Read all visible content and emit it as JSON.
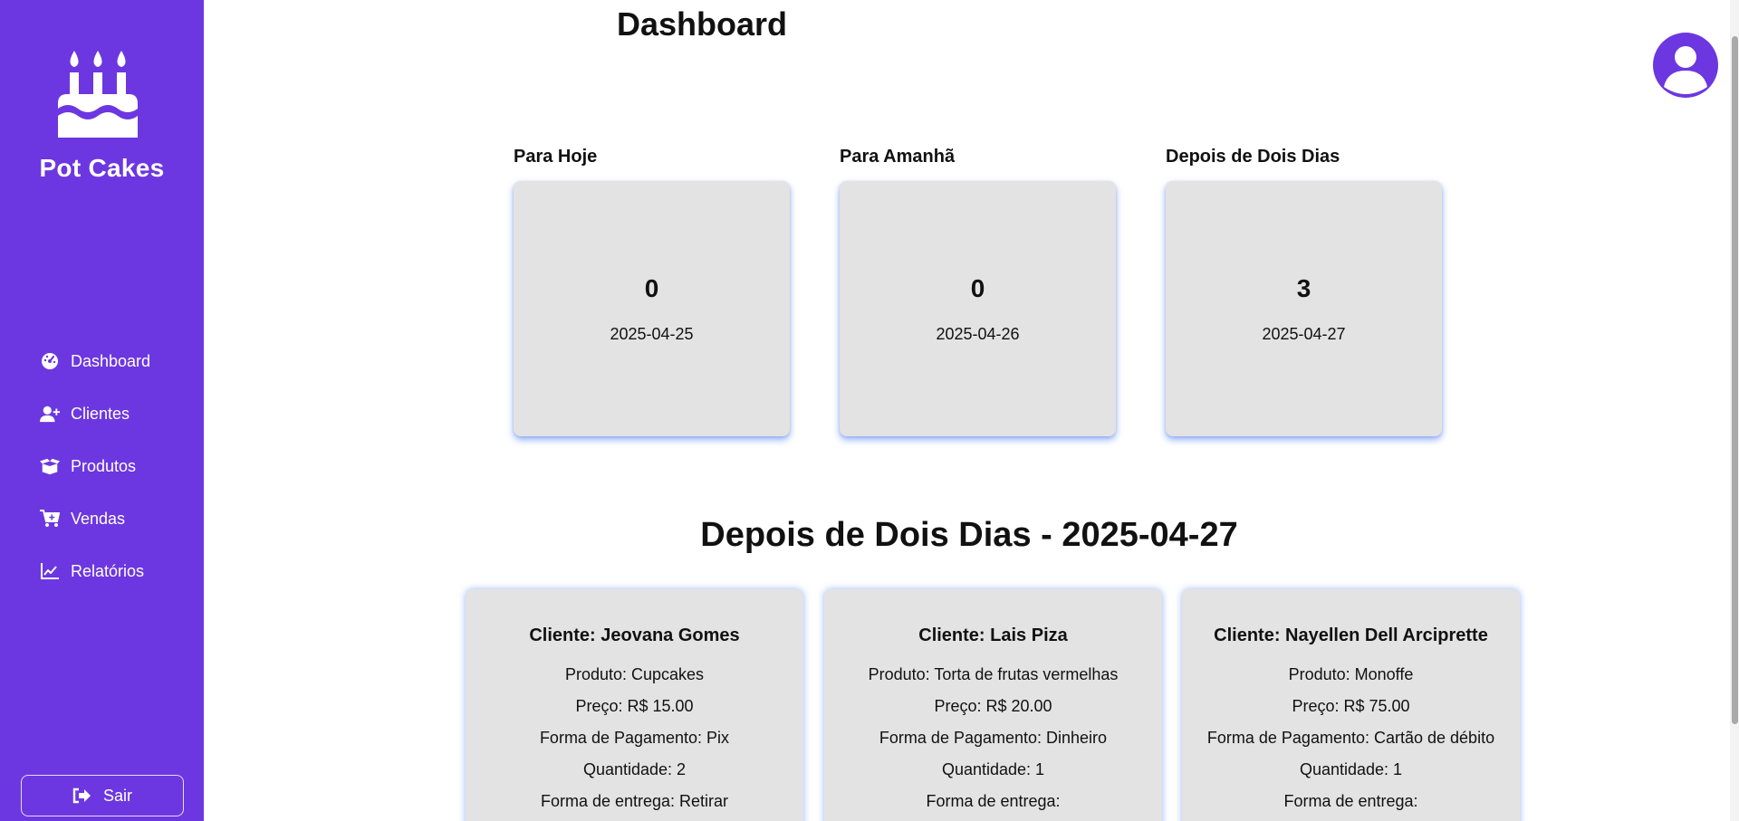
{
  "sidebar": {
    "brand": "Pot Cakes",
    "logo_icon": "birthday-cake-icon",
    "items": [
      {
        "label": "Dashboard",
        "icon": "gauge-icon"
      },
      {
        "label": "Clientes",
        "icon": "user-plus-icon"
      },
      {
        "label": "Produtos",
        "icon": "box-open-icon"
      },
      {
        "label": "Vendas",
        "icon": "cart-plus-icon"
      },
      {
        "label": "Relatórios",
        "icon": "chart-line-icon"
      }
    ],
    "logout_label": "Sair",
    "logout_icon": "sign-out-icon"
  },
  "header": {
    "title": "Dashboard",
    "avatar_icon": "user-circle-icon"
  },
  "summary": [
    {
      "caption": "Para Hoje",
      "count": "0",
      "date": "2025-04-25"
    },
    {
      "caption": "Para Amanhã",
      "count": "0",
      "date": "2025-04-26"
    },
    {
      "caption": "Depois de Dois Dias",
      "count": "3",
      "date": "2025-04-27"
    }
  ],
  "section_title": "Depois de Dois Dias - 2025-04-27",
  "orders": [
    {
      "client": "Cliente: Jeovana Gomes",
      "product": "Produto: Cupcakes",
      "price": "Preço: R$ 15.00",
      "payment": "Forma de Pagamento: Pix",
      "quantity": "Quantidade: 2",
      "delivery": "Forma de entrega: Retirar"
    },
    {
      "client": "Cliente: Lais Piza",
      "product": "Produto: Torta de frutas vermelhas",
      "price": "Preço: R$ 20.00",
      "payment": "Forma de Pagamento: Dinheiro",
      "quantity": "Quantidade: 1",
      "delivery": "Forma de entrega:"
    },
    {
      "client": "Cliente: Nayellen Dell Arciprette",
      "product": "Produto: Monoffe",
      "price": "Preço: R$ 75.00",
      "payment": "Forma de Pagamento: Cartão de débito",
      "quantity": "Quantidade: 1",
      "delivery": "Forma de entrega:"
    }
  ],
  "colors": {
    "sidebar": "#6c37e0",
    "card": "#e3e3e3",
    "card_glow": "#4278ff"
  }
}
